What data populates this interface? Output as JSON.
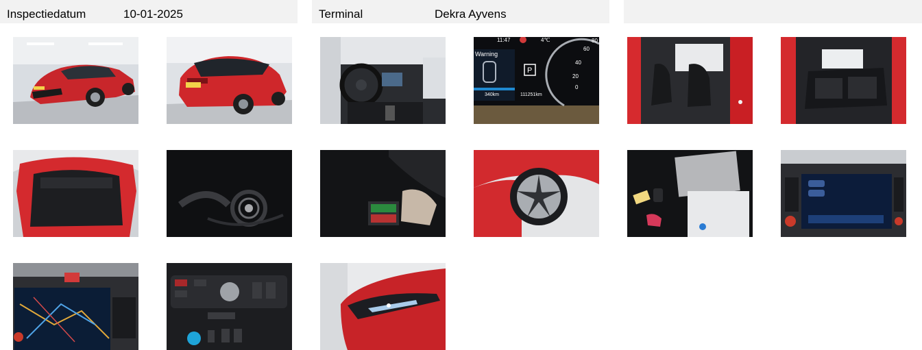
{
  "header": {
    "inspection_date_label": "Inspectiedatum",
    "inspection_date_value": "10-01-2025",
    "terminal_label": "Terminal",
    "terminal_value": "Dekra Ayvens"
  },
  "photos": [
    {
      "subject": "front-three-quarter-exterior"
    },
    {
      "subject": "rear-three-quarter-exterior"
    },
    {
      "subject": "dashboard-interior"
    },
    {
      "subject": "instrument-cluster"
    },
    {
      "subject": "front-seats"
    },
    {
      "subject": "rear-seats"
    },
    {
      "subject": "open-trunk"
    },
    {
      "subject": "charging-cable"
    },
    {
      "subject": "underfloor-storage"
    },
    {
      "subject": "wheel-rim"
    },
    {
      "subject": "keys-and-manuals"
    },
    {
      "subject": "infotainment-screen"
    },
    {
      "subject": "navigation-screen"
    },
    {
      "subject": "center-console"
    },
    {
      "subject": "headlight"
    }
  ],
  "cluster_screen": {
    "time": "11:47",
    "temp": "4℃",
    "warning": "Warning",
    "gear": "P",
    "range": "340km",
    "odometer": "111251km",
    "gauge_80": "80",
    "gauge_60": "60",
    "gauge_40": "40",
    "gauge_20": "20",
    "gauge_0": "0"
  },
  "colors": {
    "header_bg": "#f2f2f2",
    "car_red": "#d42a2a",
    "dark_interior": "#1c1c1e"
  }
}
